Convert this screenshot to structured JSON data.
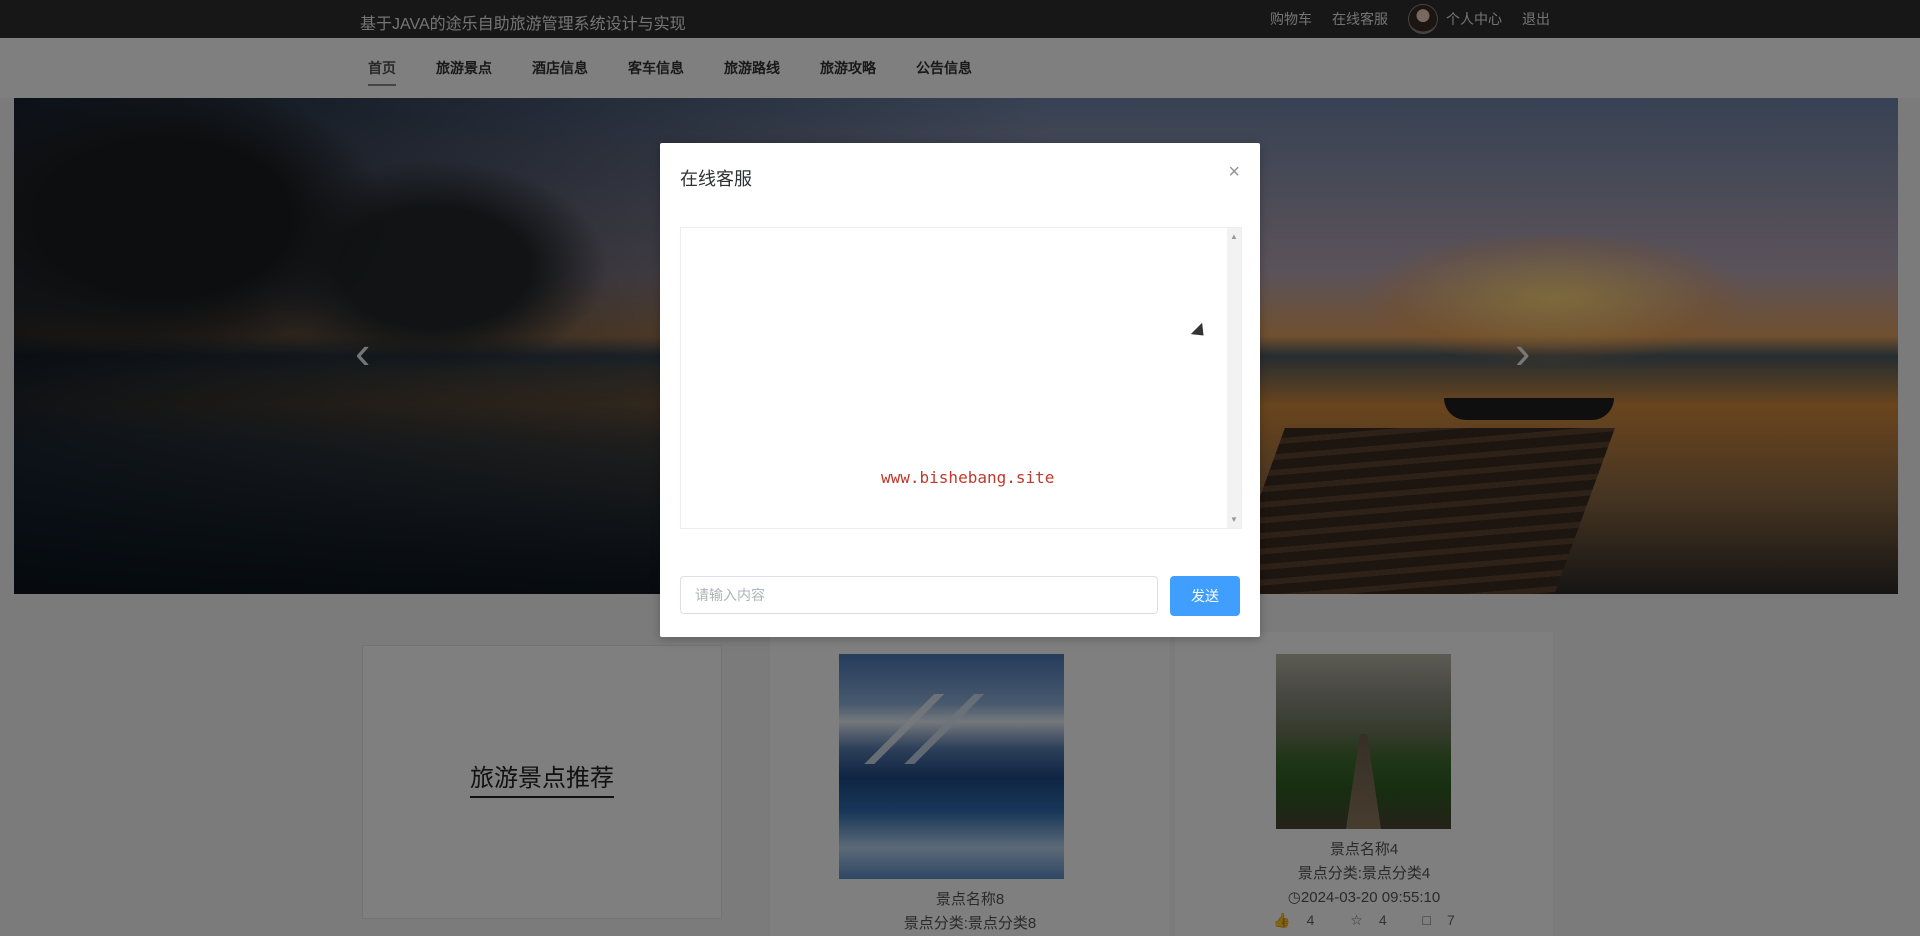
{
  "header": {
    "site_title": "基于JAVA的途乐自助旅游管理系统设计与实现",
    "links": [
      "购物车",
      "在线客服"
    ],
    "profile_label": "个人中心",
    "logout_label": "退出"
  },
  "nav": {
    "items": [
      "首页",
      "旅游景点",
      "酒店信息",
      "客车信息",
      "旅游路线",
      "旅游攻略",
      "公告信息"
    ],
    "active": "首页"
  },
  "carousel": {
    "prev_icon": "chevron-left-icon",
    "next_icon": "chevron-right-icon"
  },
  "recommend": {
    "title": "旅游景点推荐"
  },
  "spots": [
    {
      "name": "景点名称8",
      "category": "景点分类:景点分类8"
    },
    {
      "name": "景点名称4",
      "category": "景点分类:景点分类4",
      "time": "2024-03-20 09:55:10",
      "likes": "4",
      "favorites": "4",
      "comments": "7"
    }
  ],
  "modal": {
    "title": "在线客服",
    "close_icon": "close-icon",
    "watermark": "www.bishebang.site",
    "input_placeholder": "请输入内容",
    "send_label": "发送"
  },
  "colors": {
    "topbar": "#2e2e2e",
    "primary": "#409eff",
    "watermark": "#c0392b"
  }
}
